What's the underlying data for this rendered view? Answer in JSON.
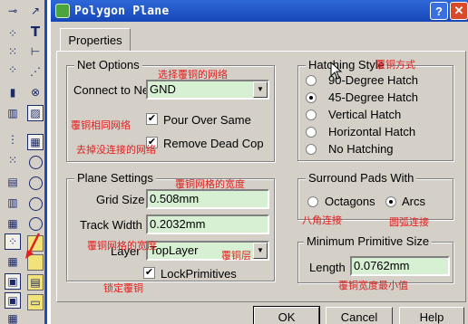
{
  "window": {
    "title": "Polygon Plane",
    "help_glyph": "?",
    "close_glyph": "✕"
  },
  "tab": {
    "label": "Properties"
  },
  "net_options": {
    "title": "Net Options",
    "connect_label": "Connect to Net",
    "connect_value": "GND",
    "pour_over_label": "Pour Over Same",
    "pour_over_checked": true,
    "remove_dead_label": "Remove Dead Copper",
    "remove_dead_checked": true
  },
  "plane_settings": {
    "title": "Plane Settings",
    "grid_label": "Grid Size",
    "grid_value": "0.508mm",
    "track_label": "Track Width",
    "track_value": "0.2032mm",
    "layer_label": "Layer",
    "layer_value": "TopLayer",
    "lock_label": "LockPrimitives",
    "lock_checked": true
  },
  "hatching": {
    "title": "Hatching Style",
    "options": [
      "90-Degree Hatch",
      "45-Degree Hatch",
      "Vertical Hatch",
      "Horizontal Hatch",
      "No Hatching"
    ],
    "selected": "45-Degree Hatch"
  },
  "surround": {
    "title": "Surround Pads With",
    "options": [
      "Octagons",
      "Arcs"
    ],
    "selected": "Arcs"
  },
  "min_size": {
    "title": "Minimum Primitive Size",
    "length_label": "Length",
    "length_value": "0.0762mm"
  },
  "buttons": {
    "ok": "OK",
    "cancel": "Cancel",
    "help": "Help"
  },
  "annotations": {
    "connect_net": "选择覆铜的网络",
    "pour_over": "覆铜相同网络",
    "remove_dead": "去掉没连接的网络",
    "grid": "覆铜网格的宽度",
    "layer_panel": "覆铜网格的宽度",
    "layer": "覆铜层",
    "lock": "锁定覆铜",
    "hatch": "覆铜方式",
    "octagons": "八角连接",
    "arcs": "圆弧连接",
    "min_width": "覆铜宽度最小值"
  },
  "marker": "1",
  "colors": {
    "field_bg": "#d7f0d3",
    "titlebar": "#1f4fb5",
    "annotation": "#e02020",
    "dialog_bg": "#d4d0c8"
  }
}
